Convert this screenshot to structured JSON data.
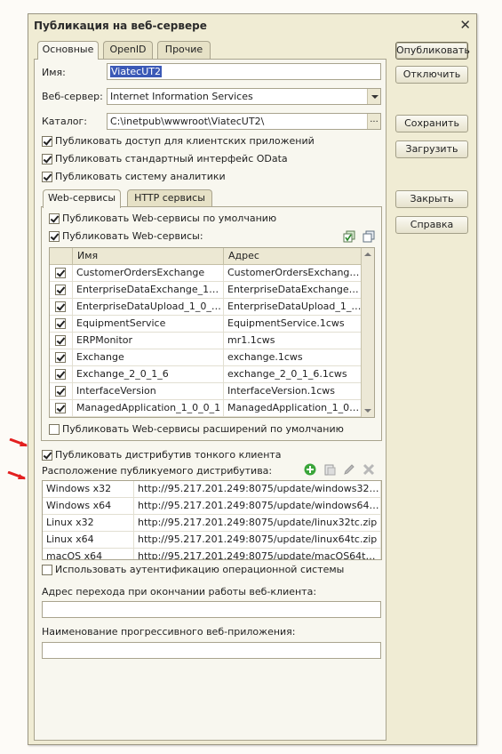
{
  "window": {
    "title": "Публикация на веб-сервере"
  },
  "tabs": [
    "Основные",
    "OpenID",
    "Прочие"
  ],
  "fields": {
    "name_label": "Имя:",
    "name_value": "ViatecUT2",
    "server_label": "Веб-сервер:",
    "server_value": "Internet Information Services",
    "catalog_label": "Каталог:",
    "catalog_value": "C:\\inetpub\\wwwroot\\ViatecUT2\\"
  },
  "checks": {
    "client_access": "Публиковать доступ для клиентских приложений",
    "odata": "Публиковать стандартный интерфейс OData",
    "analytics": "Публиковать систему аналитики",
    "ws_default": "Публиковать Web-сервисы по умолчанию",
    "ws_publish": "Публиковать Web-сервисы:",
    "ws_ext": "Публиковать Web-сервисы расширений по умолчанию",
    "thin_client": "Публиковать дистрибутив тонкого клиента",
    "os_auth": "Использовать аутентификацию операционной системы"
  },
  "inner_tabs": [
    "Web-сервисы",
    "HTTP сервисы"
  ],
  "services_table": {
    "headers": [
      "Имя",
      "Адрес"
    ],
    "rows": [
      [
        "CustomerOrdersExchange",
        "CustomerOrdersExchange.1c..."
      ],
      [
        "EnterpriseDataExchange_1_0_1...",
        "EnterpriseDataExchange_1_..."
      ],
      [
        "EnterpriseDataUpload_1_0_1_1",
        "EnterpriseDataUpload_1_0_1..."
      ],
      [
        "EquipmentService",
        "EquipmentService.1cws"
      ],
      [
        "ERPMonitor",
        "mr1.1cws"
      ],
      [
        "Exchange",
        "exchange.1cws"
      ],
      [
        "Exchange_2_0_1_6",
        "exchange_2_0_1_6.1cws"
      ],
      [
        "InterfaceVersion",
        "InterfaceVersion.1cws"
      ],
      [
        "ManagedApplication_1_0_0_1",
        "ManagedApplication_1_0_0_..."
      ]
    ]
  },
  "distrib": {
    "label": "Расположение публикуемого дистрибутива:",
    "rows": [
      [
        "Windows x32",
        "http://95.217.201.249:8075/update/windows32tc.z..."
      ],
      [
        "Windows x64",
        "http://95.217.201.249:8075/update/windows64tc.z..."
      ],
      [
        "Linux x32",
        "http://95.217.201.249:8075/update/linux32tc.zip"
      ],
      [
        "Linux x64",
        "http://95.217.201.249:8075/update/linux64tc.zip"
      ],
      [
        "macOS x64",
        "http://95.217.201.249:8075/update/macOS64tc.zip"
      ]
    ]
  },
  "exit_addr_label": "Адрес перехода при окончании работы веб-клиента:",
  "pwa_label": "Наименование прогрессивного веб-приложения:",
  "buttons": {
    "publish": "Опубликовать",
    "disable": "Отключить",
    "save": "Сохранить",
    "load": "Загрузить",
    "close": "Закрыть",
    "help": "Справка"
  },
  "colors": {
    "selection": "#3b59b6",
    "arrow": "#e32020",
    "add_icon": "#3aa53a"
  }
}
